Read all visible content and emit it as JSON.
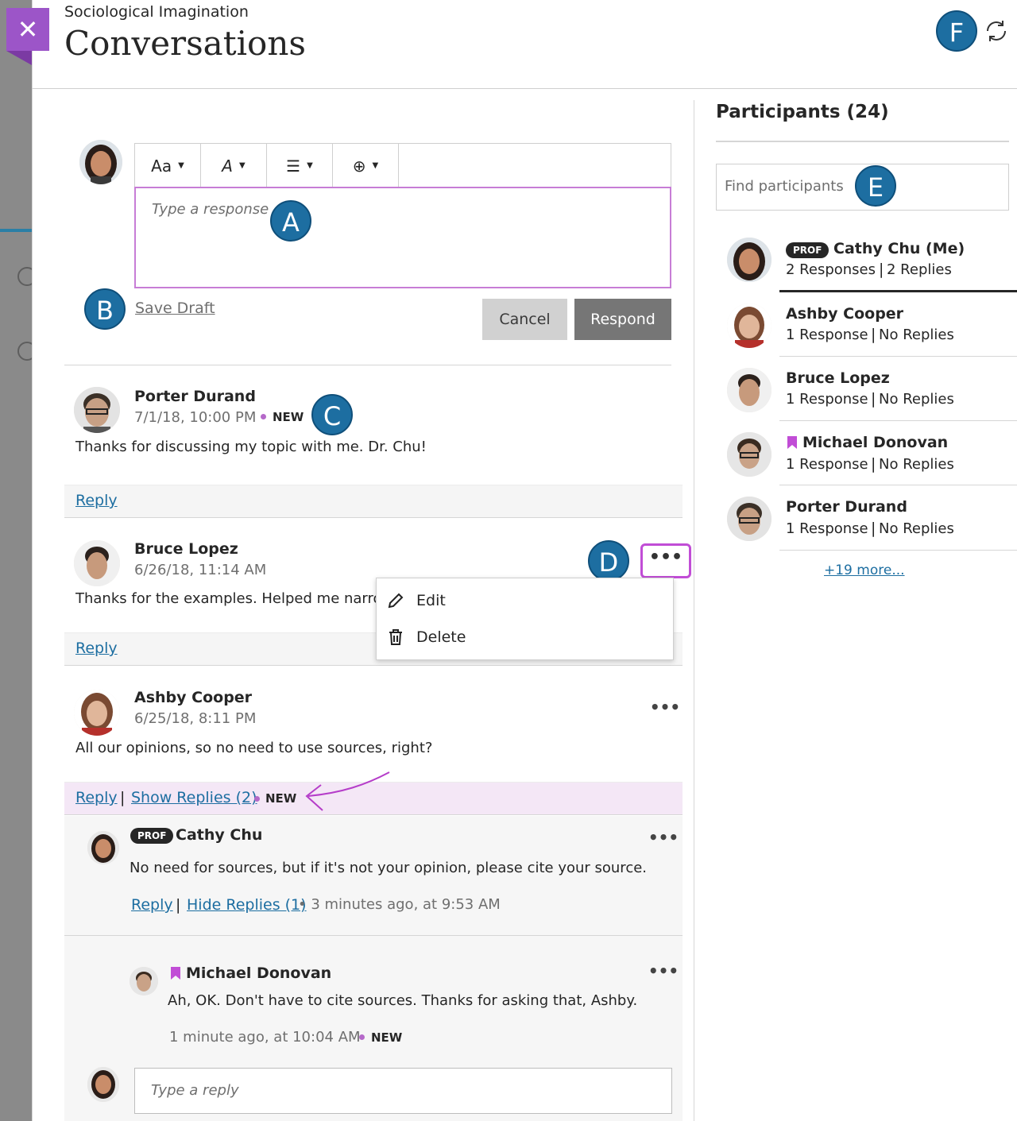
{
  "header": {
    "breadcrumb": "Sociological Imagination",
    "title": "Conversations",
    "user_initial": "F"
  },
  "callouts": {
    "a": "A",
    "b": "B",
    "c": "C",
    "d": "D",
    "e": "E"
  },
  "composer": {
    "placeholder": "Type a response",
    "save_draft": "Save Draft",
    "cancel": "Cancel",
    "respond": "Respond",
    "toolbar": [
      "text-size",
      "text-style",
      "list",
      "insert"
    ]
  },
  "posts": [
    {
      "author": "Porter Durand",
      "date": "7/1/18, 10:00 PM",
      "new": "NEW",
      "text": "Thanks for discussing my topic with me. Dr. Chu!",
      "reply": "Reply"
    },
    {
      "author": "Bruce Lopez",
      "date": "6/26/18, 11:14 AM",
      "text": "Thanks for the examples. Helped me narrow",
      "reply": "Reply"
    },
    {
      "author": "Ashby Cooper",
      "date": "6/25/18, 8:11 PM",
      "text": "All our opinions, so no need to use sources, right?",
      "reply": "Reply",
      "show_replies": "Show Replies (2)",
      "new": "NEW"
    }
  ],
  "context_menu": {
    "edit": "Edit",
    "delete": "Delete"
  },
  "replies": [
    {
      "badge": "PROF",
      "author": "Cathy Chu",
      "text": "No need for sources, but if it's not your opinion, please cite your source.",
      "reply": "Reply",
      "hide_replies": "Hide Replies (1)",
      "time": "• 3 minutes ago, at 9:53 AM"
    },
    {
      "author": "Michael Donovan",
      "text": "Ah, OK. Don't have to cite sources. Thanks for asking that, Ashby.",
      "time": "1 minute ago, at 10:04 AM",
      "new": "NEW"
    }
  ],
  "reply_input": {
    "placeholder": "Type a reply"
  },
  "participants": {
    "title": "Participants (24)",
    "search_placeholder": "Find participants",
    "items": [
      {
        "badge": "PROF",
        "name": "Cathy Chu (Me)",
        "responses": "2 Responses",
        "replies": "2 Replies"
      },
      {
        "name": "Ashby Cooper",
        "responses": "1 Response",
        "replies": "No Replies"
      },
      {
        "name": "Bruce Lopez",
        "responses": "1 Response",
        "replies": "No Replies"
      },
      {
        "name": "Michael Donovan",
        "responses": "1 Response",
        "replies": "No Replies"
      },
      {
        "name": "Porter Durand",
        "responses": "1 Response",
        "replies": "No Replies"
      }
    ],
    "more": "+19 more..."
  },
  "colors": {
    "accent": "#9c55c8",
    "badge": "#1d6ea1",
    "link": "#1d6ea1",
    "highlight": "#f4e7f6"
  }
}
